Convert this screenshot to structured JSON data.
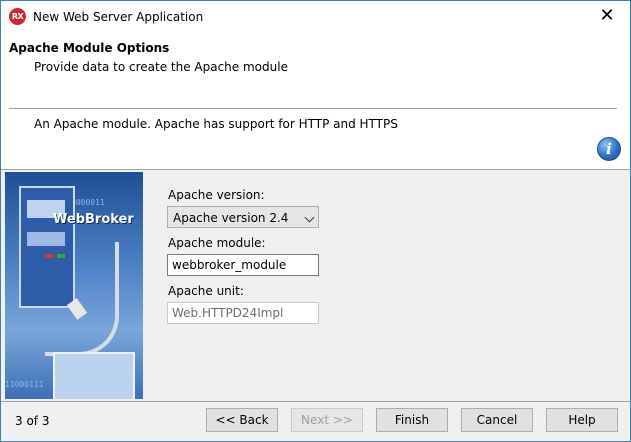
{
  "window": {
    "title": "New Web Server Application",
    "app_icon_text": "RX",
    "close_glyph": "✕"
  },
  "header": {
    "title": "Apache Module Options",
    "subtitle": "Provide data to create the Apache module",
    "description": "An Apache module. Apache has support for HTTP and HTTPS",
    "info_icon_glyph": "i"
  },
  "side_image": {
    "label": "WebBroker",
    "binary_top": "0000011",
    "binary_bottom": "11000111"
  },
  "form": {
    "apache_version_label": "Apache version:",
    "apache_version_value": "Apache version 2.4",
    "apache_module_label": "Apache module:",
    "apache_module_value": "webbroker_module",
    "apache_unit_label": "Apache unit:",
    "apache_unit_value": "Web.HTTPD24Impl"
  },
  "footer": {
    "step": "3 of 3",
    "back_label": "<< Back",
    "next_label": "Next >>",
    "finish_label": "Finish",
    "cancel_label": "Cancel",
    "help_label": "Help"
  }
}
